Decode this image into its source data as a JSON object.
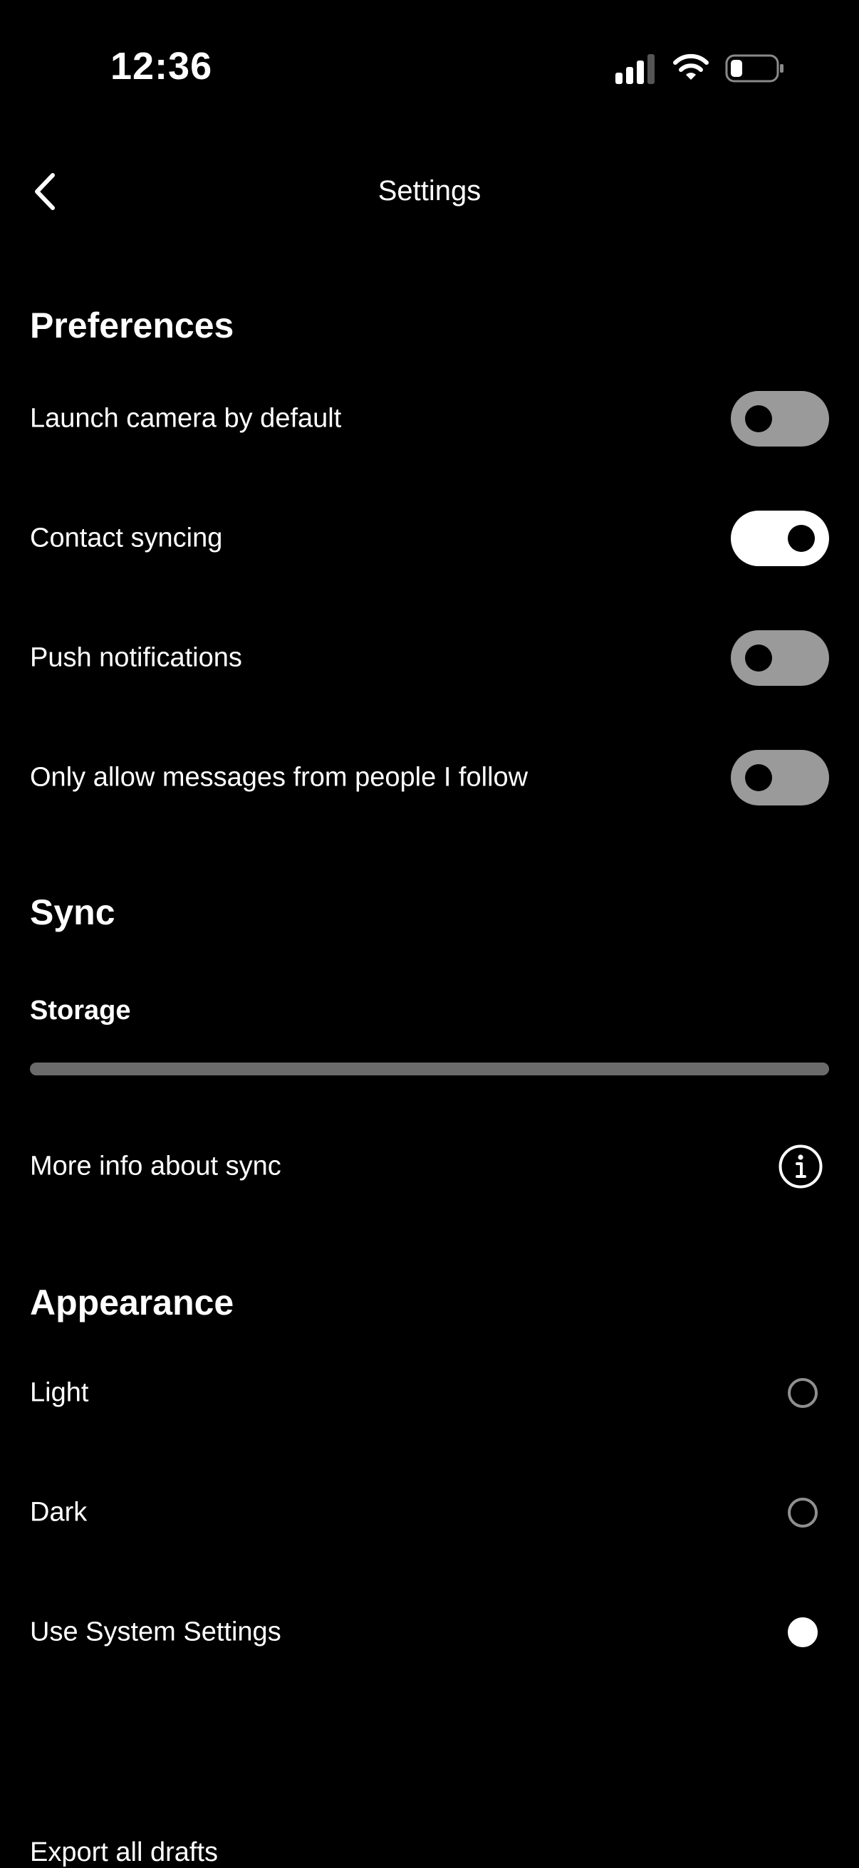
{
  "status_bar": {
    "time": "12:36"
  },
  "nav": {
    "title": "Settings"
  },
  "preferences": {
    "title": "Preferences",
    "items": [
      {
        "label": "Launch camera by default",
        "on": false
      },
      {
        "label": "Contact syncing",
        "on": true
      },
      {
        "label": "Push notifications",
        "on": false
      },
      {
        "label": "Only allow messages from people I follow",
        "on": false
      }
    ]
  },
  "sync": {
    "title": "Sync",
    "storage_label": "Storage",
    "storage_fraction": 0,
    "more_info_label": "More info about sync"
  },
  "appearance": {
    "title": "Appearance",
    "options": [
      {
        "label": "Light",
        "selected": false
      },
      {
        "label": "Dark",
        "selected": false
      },
      {
        "label": "Use System Settings",
        "selected": true
      }
    ]
  },
  "export": {
    "label": "Export all drafts"
  },
  "colors": {
    "background": "#000000",
    "text": "#ffffff",
    "toggle_off": "#9a9a9a",
    "toggle_on": "#ffffff",
    "storage_track": "#6b6b6b"
  }
}
